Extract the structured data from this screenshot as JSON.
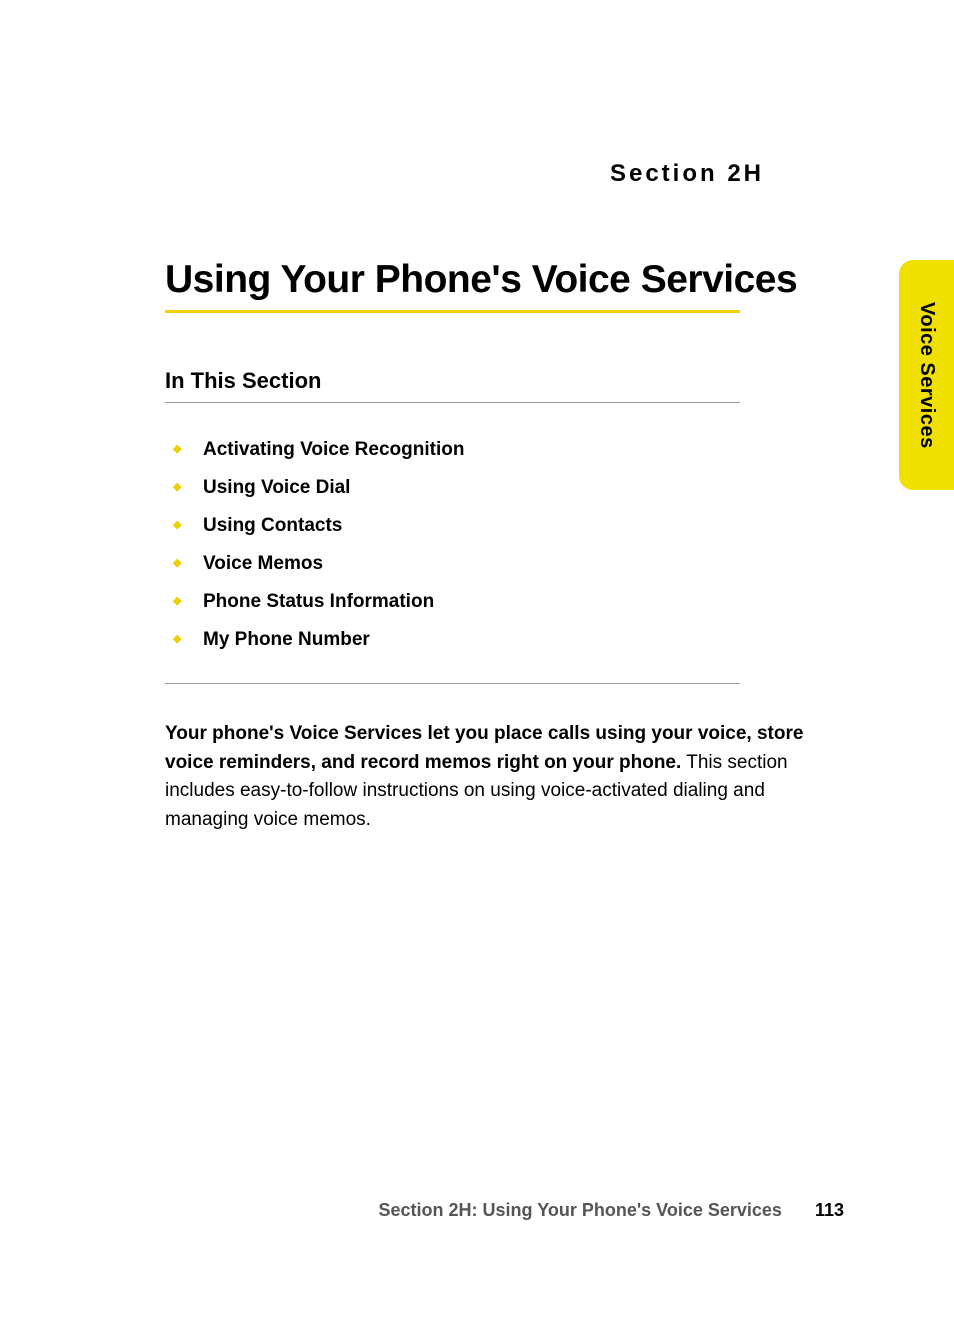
{
  "section_label": "Section 2H",
  "main_title": "Using Your Phone's Voice Services",
  "subsection_title": "In This Section",
  "bullets": [
    "Activating Voice Recognition",
    "Using Voice Dial",
    "Using Contacts",
    "Voice Memos",
    "Phone Status Information",
    "My Phone Number"
  ],
  "intro_bold": "Your phone's Voice Services let you place calls using your voice, store voice reminders, and record memos right on your phone.",
  "intro_regular": " This section includes easy-to-follow instructions on using voice-activated dialing and managing voice memos.",
  "side_tab": "Voice Services",
  "footer_text": "Section 2H: Using Your Phone's Voice Services",
  "page_number": "113"
}
